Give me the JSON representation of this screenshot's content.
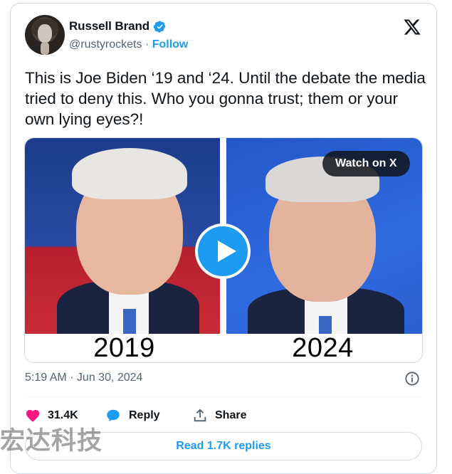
{
  "author": {
    "name": "Russell Brand",
    "handle": "@rustyrockets",
    "separator": "·",
    "follow_label": "Follow",
    "verified_icon": "verified-badge-icon",
    "verified_color": "#1d9bf0"
  },
  "tweet": {
    "text": "This is Joe Biden ‘19 and ‘24. Until the debate the media tried to deny this. Who you gonna trust; them or your own lying eyes?!"
  },
  "media": {
    "left_year": "2019",
    "right_year": "2024",
    "watch_label": "Watch on X",
    "play_icon": "play-icon"
  },
  "meta": {
    "timestamp": "5:19 AM · Jun 30, 2024",
    "info_icon": "info-icon"
  },
  "actions": {
    "likes": "31.4K",
    "reply_label": "Reply",
    "share_label": "Share",
    "like_color": "#f91880",
    "reply_color": "#1d9bf0"
  },
  "read_replies_label": "Read 1.7K replies",
  "watermark": "宏达科技",
  "colors": {
    "accent": "#1d9bf0",
    "text": "#0f1419",
    "muted": "#536471",
    "border": "#cfd9de"
  }
}
